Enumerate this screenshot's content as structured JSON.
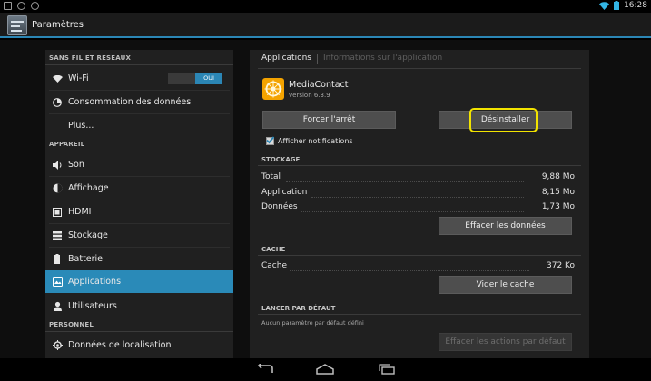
{
  "status_bar": {
    "time": "16:28"
  },
  "action_bar": {
    "title": "Paramètres"
  },
  "sidebar": {
    "sections": {
      "wireless": "SANS FIL ET RÉSEAUX",
      "device": "APPAREIL",
      "personal": "PERSONNEL"
    },
    "items": [
      {
        "label": "Wi-Fi",
        "icon": "wifi-icon",
        "toggle": "OUI"
      },
      {
        "label": "Consommation des données",
        "icon": "data-usage-icon"
      },
      {
        "label": "Plus...",
        "icon": ""
      },
      {
        "label": "Son",
        "icon": "speaker-icon"
      },
      {
        "label": "Affichage",
        "icon": "brightness-icon"
      },
      {
        "label": "HDMI",
        "icon": "hdmi-icon"
      },
      {
        "label": "Stockage",
        "icon": "storage-icon"
      },
      {
        "label": "Batterie",
        "icon": "battery-icon"
      },
      {
        "label": "Applications",
        "icon": "applications-icon",
        "active": true
      },
      {
        "label": "Utilisateurs",
        "icon": "users-icon"
      },
      {
        "label": "Données de localisation",
        "icon": "location-icon"
      }
    ]
  },
  "detail": {
    "breadcrumb": {
      "current": "Applications",
      "next": "Informations sur l'application"
    },
    "app": {
      "name": "MediaContact",
      "version": "version 6.3.9"
    },
    "buttons": {
      "force_stop": "Forcer l'arrêt",
      "uninstall": "Désinstaller",
      "clear_data": "Effacer les données",
      "clear_cache": "Vider le cache",
      "clear_defaults": "Effacer les actions par défaut"
    },
    "show_notifications": {
      "label": "Afficher notifications",
      "checked": true
    },
    "storage": {
      "header": "STOCKAGE",
      "rows": [
        {
          "label": "Total",
          "value": "9,88 Mo"
        },
        {
          "label": "Application",
          "value": "8,15 Mo"
        },
        {
          "label": "Données",
          "value": "1,73 Mo"
        }
      ]
    },
    "cache": {
      "header": "CACHE",
      "rows": [
        {
          "label": "Cache",
          "value": "372 Ko"
        }
      ]
    },
    "launch_default": {
      "header": "LANCER PAR DÉFAUT",
      "note": "Aucun paramètre par défaut défini"
    }
  },
  "colors": {
    "accent": "#2b86b5",
    "highlight": "#f2e300",
    "app_logo": "#f4a300"
  }
}
